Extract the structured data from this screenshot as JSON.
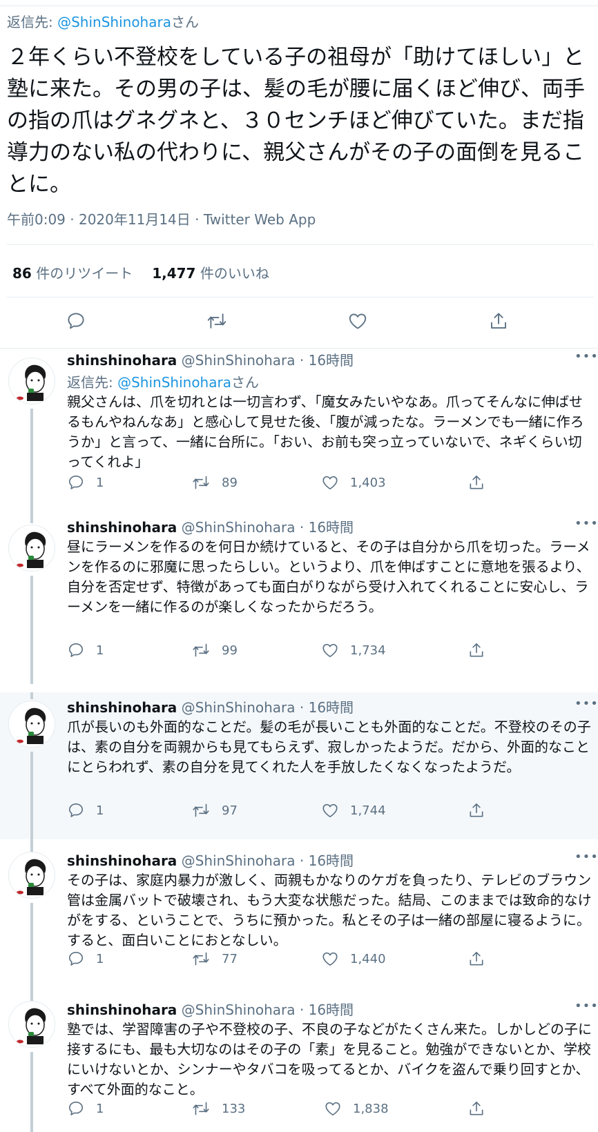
{
  "main": {
    "reply_prefix": "返信先: ",
    "reply_mention": "@ShinShinohara",
    "reply_suffix": "さん",
    "text": "２年くらい不登校をしている子の祖母が「助けてほしい」と塾に来た。その男の子は、髪の毛が腰に届くほど伸び、両手の指の爪はグネグネと、３０センチほど伸びていた。まだ指導力のない私の代わりに、親父さんがその子の面倒を見ることに。",
    "meta": "午前0:09 · 2020年11月14日 · Twitter Web App",
    "retweet_count": "86",
    "retweet_label": " 件のリツイート",
    "like_count": "1,477",
    "like_label": " 件のいいね"
  },
  "icons": {
    "reply": "reply-bubble-icon",
    "retweet": "retweet-arrows-icon",
    "like": "heart-icon",
    "share": "share-upload-icon",
    "more": "more-dots-icon",
    "avatar": "cartoon-avatar"
  },
  "colors": {
    "link": "#1b95e0",
    "muted": "#5b7083",
    "text": "#0f1419",
    "highlight_bg": "#f5f8fa"
  },
  "replies": [
    {
      "name": "shinshinohara",
      "handle_time": " @ShinShinohara · 16時間",
      "reply_prefix": "返信先: ",
      "reply_mention": "@ShinShinohara",
      "reply_suffix": "さん",
      "text": "親父さんは、爪を切れとは一切言わず、「魔女みたいやなあ。爪ってそんなに伸ばせるもんやねんなあ」と感心して見せた後、「腹が減ったな。ラーメンでも一緒に作ろうか」と言って、一緒に台所に。「おい、お前も突っ立っていないで、ネギくらい切ってくれよ」",
      "replies": "1",
      "retweets": "89",
      "likes": "1,403"
    },
    {
      "name": "shinshinohara",
      "handle_time": " @ShinShinohara · 16時間",
      "text": "昼にラーメンを作るのを何日か続けていると、その子は自分から爪を切った。ラーメンを作るのに邪魔に思ったらしい。というより、爪を伸ばすことに意地を張るより、自分を否定せず、特徴があっても面白がりながら受け入れてくれることに安心し、ラーメンを一緒に作るのが楽しくなったからだろう。",
      "replies": "1",
      "retweets": "99",
      "likes": "1,734"
    },
    {
      "name": "shinshinohara",
      "handle_time": " @ShinShinohara · 16時間",
      "text": "爪が長いのも外面的なことだ。髪の毛が長いことも外面的なことだ。不登校のその子は、素の自分を両親からも見てもらえず、寂しかったようだ。だから、外面的なことにとらわれず、素の自分を見てくれた人を手放したくなくなったようだ。",
      "replies": "1",
      "retweets": "97",
      "likes": "1,744"
    },
    {
      "name": "shinshinohara",
      "handle_time": " @ShinShinohara · 16時間",
      "text": "その子は、家庭内暴力が激しく、両親もかなりのケガを負ったり、テレビのブラウン管は金属バットで破壊され、もう大変な状態だった。結局、このままでは致命的なけがをする、ということで、うちに預かった。私とその子は一緒の部屋に寝るように。すると、面白いことにおとなしい。",
      "replies": "1",
      "retweets": "77",
      "likes": "1,440"
    },
    {
      "name": "shinshinohara",
      "handle_time": " @ShinShinohara · 16時間",
      "text": "塾では、学習障害の子や不登校の子、不良の子などがたくさん来た。しかしどの子に接するにも、最も大切なのはその子の「素」を見ること。勉強ができないとか、学校にいけないとか、シンナーやタバコを吸ってるとか、バイクを盗んで乗り回すとか、すべて外面的なこと。",
      "replies": "1",
      "retweets": "133",
      "likes": "1,838"
    }
  ]
}
